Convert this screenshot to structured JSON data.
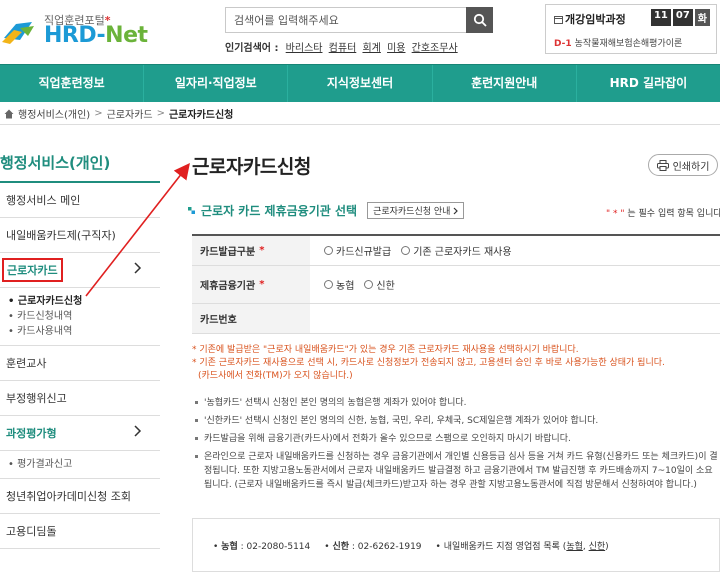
{
  "header": {
    "logo_sub": "직업훈련포털",
    "logo_main": "HRD-",
    "logo_main_net": "Net",
    "search": {
      "placeholder": "검색어를 입력해주세요"
    },
    "popular_label": "인기검색어 :",
    "popular_terms": [
      "바리스타",
      "컴퓨터",
      "회계",
      "미용",
      "간호조무사"
    ],
    "open_course": {
      "title": "개강임박과정",
      "month": "11",
      "date": "07",
      "weekday": "화",
      "dday": "D-1",
      "course": "농작물재해보험손해평가이론"
    }
  },
  "nav": {
    "items": [
      "직업훈련정보",
      "일자리·직업정보",
      "지식정보센터",
      "훈련지원안내",
      "HRD 길라잡이"
    ]
  },
  "breadcrumb": {
    "items": [
      "행정서비스(개인)",
      "근로자카드"
    ],
    "current": "근로자카드신청"
  },
  "sidebar": {
    "title": "행정서비스(개인)",
    "items": [
      {
        "label": "행정서비스 메인"
      },
      {
        "label": "내일배움카드제(구직자)"
      },
      {
        "label": "근로자카드"
      }
    ],
    "sub_items": [
      "근로자카드신청",
      "카드신청내역",
      "카드사용내역"
    ],
    "items_after": [
      {
        "label": "훈련교사"
      },
      {
        "label": "부정행위신고"
      },
      {
        "label": "과정평가형"
      }
    ],
    "sub_items_2": [
      "평가결과신고"
    ],
    "items_last": [
      {
        "label": "청년취업아카데미신청 조회"
      },
      {
        "label": "고용디딤돌"
      }
    ]
  },
  "main": {
    "title": "근로자카드신청",
    "print_label": "인쇄하기",
    "section_title": "근로자 카드 제휴금융기관 선택",
    "guide_label": "근로자카드신청 안내",
    "required_note_suffix": "는 필수 입력 항목 입니다.",
    "required_note_mark": "\" * \"",
    "form": {
      "row1_label": "카드발급구분",
      "row1_options": [
        "카드신규발급",
        "기존 근로자카드 재사용"
      ],
      "row2_label": "제휴금융기관",
      "row2_options": [
        "농협",
        "신한"
      ],
      "row3_label": "카드번호"
    },
    "warnings": [
      "* 기존에 발급받은 \"근로자 내일배움카드\"가 있는 경우 기존 근로자카드 재사용을 선택하시기 바랍니다.",
      "* 기존 근로자카드 재사용으로 선택 시, 카드사로 신청정보가 전송되지 않고, 고용센터 승인 후 바로 사용가능한 상태가 됩니다.",
      "(카드사에서 전화(TM)가 오지 않습니다.)"
    ],
    "info": [
      "'농협카드' 선택시 신청인 본인 명의의 농협은행 계좌가 있어야 합니다.",
      "'신한카드' 선택시 신청인 본인 명의의 신한, 농협, 국민, 우리, 우체국, SC제일은행 계좌가 있어야 합니다.",
      "카드발급을 위해 금융기관(카드사)에서 전화가 올수 있으므로 스팸으로 오인하지 마시기 바랍니다.",
      "온라인으로 근로자 내일배움카드를 신청하는 경우 금융기관에서 개인별 신용등급 심사 등을 거쳐 카드 유형(신용카드 또는 체크카드)이 결정됩니다. 또한 지방고용노동관서에서 근로자 내일배움카드 발급결정 하고 금융기관에서 TM 발급진행 후 카드배송까지 7~10일이 소요됩니다. (근로자 내일배움카드를 즉시 발급(체크카드)받고자 하는 경우 관할 지방고용노동관서에 직접 방문해서 신청하여야 합니다.)"
    ],
    "contact": {
      "nh_label": "농협",
      "nh_phone": ": 02-2080-5114",
      "sh_label": "신한",
      "sh_phone": ": 02-6262-1919",
      "branch_text": "내일배움카드 지점 영업점 목록 (",
      "branch_nh": "농협",
      "branch_sh": "신한",
      "branch_close": ")"
    }
  },
  "colors": {
    "accent": "#1f9d8d",
    "highlight": "#e02020",
    "logo_blue": "#1c9ad6"
  }
}
